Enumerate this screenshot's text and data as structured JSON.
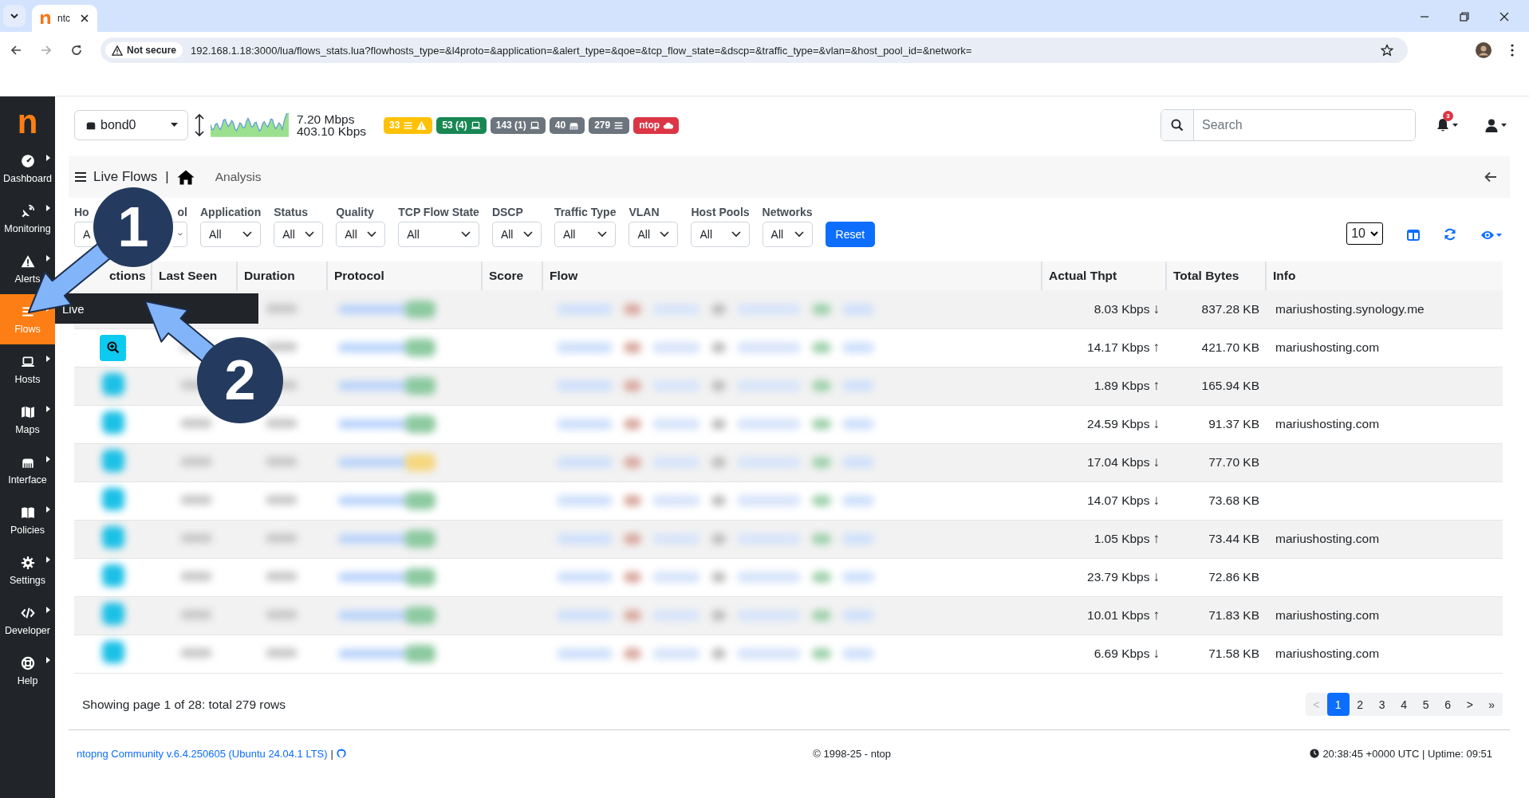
{
  "browser": {
    "tab_title": "ntc",
    "security_label": "Not secure",
    "url": "192.168.1.18:3000/lua/flows_stats.lua?flowhosts_type=&l4proto=&application=&alert_type=&qoe=&tcp_flow_state=&dscp=&traffic_type=&vlan=&host_pool_id=&network="
  },
  "logo": "n",
  "sidebar": [
    {
      "label": "Dashboard",
      "selected": false
    },
    {
      "label": "Monitoring",
      "selected": false
    },
    {
      "label": "Alerts",
      "selected": false
    },
    {
      "label": "Flows",
      "selected": true
    },
    {
      "label": "Hosts",
      "selected": false
    },
    {
      "label": "Maps",
      "selected": false
    },
    {
      "label": "Interface",
      "selected": false
    },
    {
      "label": "Policies",
      "selected": false
    },
    {
      "label": "Settings",
      "selected": false
    },
    {
      "label": "Developer",
      "selected": false
    },
    {
      "label": "Help",
      "selected": false
    }
  ],
  "submenu": {
    "label": "Live"
  },
  "interface_select": {
    "value": "bond0"
  },
  "throughput": {
    "upper": "7.20 Mbps",
    "lower": "403.10 Kbps"
  },
  "badges": [
    {
      "text": "33",
      "color": "#ffc107"
    },
    {
      "text": "53 (4)",
      "color": "#198754"
    },
    {
      "text": "143 (1)",
      "color": "#6c757d"
    },
    {
      "text": "40",
      "color": "#6c757d"
    },
    {
      "text": "279",
      "color": "#6c757d"
    },
    {
      "text": "ntop",
      "color": "#dc3545"
    }
  ],
  "search": {
    "placeholder": "Search"
  },
  "notifications": {
    "count": "3"
  },
  "breadcrumb": {
    "title": "Live Flows",
    "separator": "|",
    "section": "Analysis"
  },
  "filters": [
    {
      "label": "Ho",
      "value": "A"
    },
    {
      "label": "ol"
    },
    {
      "label": "Application",
      "value": "All"
    },
    {
      "label": "Status",
      "value": "All"
    },
    {
      "label": "Quality",
      "value": "All"
    },
    {
      "label": "TCP Flow State",
      "value": "All"
    },
    {
      "label": "DSCP",
      "value": "All"
    },
    {
      "label": "Traffic Type",
      "value": "All"
    },
    {
      "label": "VLAN",
      "value": "All"
    },
    {
      "label": "Host Pools",
      "value": "All"
    },
    {
      "label": "Networks",
      "value": "All"
    }
  ],
  "reset_button": "Reset",
  "page_size": "10",
  "table": {
    "columns": [
      "ctions",
      "Last Seen",
      "Duration",
      "Protocol",
      "Score",
      "Flow",
      "Actual Thpt",
      "Total Bytes",
      "Info"
    ],
    "rows": [
      {
        "kind": "covered",
        "color": "#8cc9a0",
        "thpt": "8.03 Kbps",
        "arrow": "↓",
        "bytes": "837.28 KB",
        "info": "mariushosting.synology.me"
      },
      {
        "kind": "clear",
        "color": "#8cc9a0",
        "thpt": "14.17 Kbps",
        "arrow": "↑",
        "bytes": "421.70 KB",
        "info": "mariushosting.com"
      },
      {
        "kind": "blurred",
        "color": "#8cc9a0",
        "thpt": "1.89 Kbps",
        "arrow": "↑",
        "bytes": "165.94 KB"
      },
      {
        "kind": "blurred",
        "color": "#8cc9a0",
        "thpt": "24.59 Kbps",
        "arrow": "↓",
        "bytes": "91.37 KB",
        "info": "mariushosting.com"
      },
      {
        "kind": "blurred",
        "color": "#f6d77f",
        "thpt": "17.04 Kbps",
        "arrow": "↓",
        "bytes": "77.70 KB"
      },
      {
        "kind": "blurred",
        "color": "#8cc9a0",
        "thpt": "14.07 Kbps",
        "arrow": "↓",
        "bytes": "73.68 KB"
      },
      {
        "kind": "blurred",
        "color": "#8cc9a0",
        "thpt": "1.05 Kbps",
        "arrow": "↑",
        "bytes": "73.44 KB",
        "info": "mariushosting.com"
      },
      {
        "kind": "blurred",
        "color": "#8cc9a0",
        "thpt": "23.79 Kbps",
        "arrow": "↓",
        "bytes": "72.86 KB"
      },
      {
        "kind": "blurred",
        "color": "#8cc9a0",
        "thpt": "10.01 Kbps",
        "arrow": "↑",
        "bytes": "71.83 KB",
        "info": "mariushosting.com"
      },
      {
        "kind": "blurred",
        "color": "#8cc9a0",
        "thpt": "6.69 Kbps",
        "arrow": "↓",
        "bytes": "71.58 KB",
        "info": "mariushosting.com"
      }
    ]
  },
  "summary": "Showing page 1 of 28: total 279 rows",
  "pagination": [
    {
      "label": "<",
      "selected": false,
      "disabled": true
    },
    {
      "label": "1",
      "selected": true,
      "disabled": false
    },
    {
      "label": "2",
      "selected": false,
      "disabled": false
    },
    {
      "label": "3",
      "selected": false,
      "disabled": false
    },
    {
      "label": "4",
      "selected": false,
      "disabled": false
    },
    {
      "label": "5",
      "selected": false,
      "disabled": false
    },
    {
      "label": "6",
      "selected": false,
      "disabled": false
    },
    {
      "label": ">",
      "selected": false,
      "disabled": false
    },
    {
      "label": "»",
      "selected": false,
      "disabled": false
    }
  ],
  "footer": {
    "version": "ntopng Community v.6.4.250605 (Ubuntu 24.04.1 LTS)",
    "separator": "|",
    "copyright": "© 1998-25 - ntop",
    "time": "20:38:45 +0000 UTC | Uptime: 09:51"
  },
  "annotations": [
    {
      "number": "1"
    },
    {
      "number": "2"
    }
  ]
}
